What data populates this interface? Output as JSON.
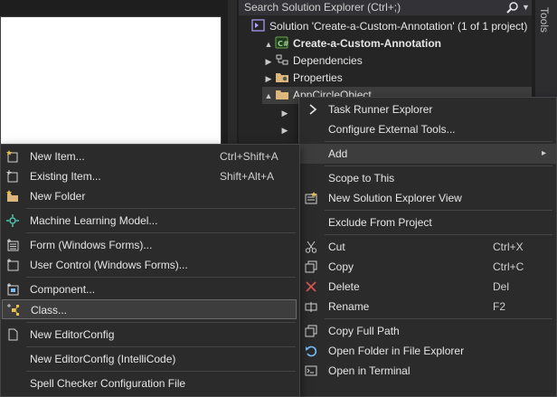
{
  "solution_explorer": {
    "search_placeholder": "Search Solution Explorer (Ctrl+;)",
    "tree": [
      {
        "label": "Solution 'Create-a-Custom-Annotation' (1 of 1 project)",
        "icon": "solution-icon"
      },
      {
        "label": "Create-a-Custom-Annotation",
        "icon": "csharp-project-icon",
        "expander": "▲"
      },
      {
        "label": "Dependencies",
        "icon": "dependencies-icon",
        "expander": "▶"
      },
      {
        "label": "Properties",
        "icon": "properties-folder-icon",
        "expander": "▶"
      },
      {
        "label": "AppCircleObject",
        "icon": "folder-icon",
        "expander": "▲"
      }
    ]
  },
  "tools_tab": "Tools",
  "context_menu": {
    "items": [
      {
        "label": "Task Runner Explorer",
        "icon": "task-runner-icon"
      },
      {
        "label": "Configure External Tools..."
      },
      {
        "label": "Add",
        "submenu": "▸"
      },
      {
        "label": "Scope to This"
      },
      {
        "label": "New Solution Explorer View",
        "icon": "new-view-icon"
      },
      {
        "label": "Exclude From Project"
      },
      {
        "label": "Cut",
        "shortcut": "Ctrl+X",
        "icon": "cut-icon"
      },
      {
        "label": "Copy",
        "shortcut": "Ctrl+C",
        "icon": "copy-icon"
      },
      {
        "label": "Delete",
        "shortcut": "Del",
        "icon": "delete-icon"
      },
      {
        "label": "Rename",
        "shortcut": "F2",
        "icon": "rename-icon"
      },
      {
        "label": "Copy Full Path",
        "icon": "copy-path-icon"
      },
      {
        "label": "Open Folder in File Explorer",
        "icon": "open-folder-icon"
      },
      {
        "label": "Open in Terminal",
        "icon": "terminal-icon"
      }
    ]
  },
  "add_submenu": {
    "items": [
      {
        "label": "New Item...",
        "shortcut": "Ctrl+Shift+A",
        "icon": "new-item-icon"
      },
      {
        "label": "Existing Item...",
        "shortcut": "Shift+Alt+A",
        "icon": "existing-item-icon"
      },
      {
        "label": "New Folder",
        "icon": "new-folder-icon"
      },
      {
        "label": "Machine Learning Model...",
        "icon": "ml-model-icon"
      },
      {
        "label": "Form (Windows Forms)...",
        "icon": "form-icon"
      },
      {
        "label": "User Control (Windows Forms)...",
        "icon": "user-control-icon"
      },
      {
        "label": "Component...",
        "icon": "component-icon"
      },
      {
        "label": "Class...",
        "icon": "class-icon"
      },
      {
        "label": "New EditorConfig",
        "icon": "editorconfig-icon"
      },
      {
        "label": "New EditorConfig (IntelliCode)"
      },
      {
        "label": "Spell Checker Configuration File"
      }
    ]
  },
  "colors": {
    "accent": "#75beff",
    "background": "#1f1f1f",
    "menu": "#2b2b2b",
    "highlight": "#3d3d3d"
  }
}
